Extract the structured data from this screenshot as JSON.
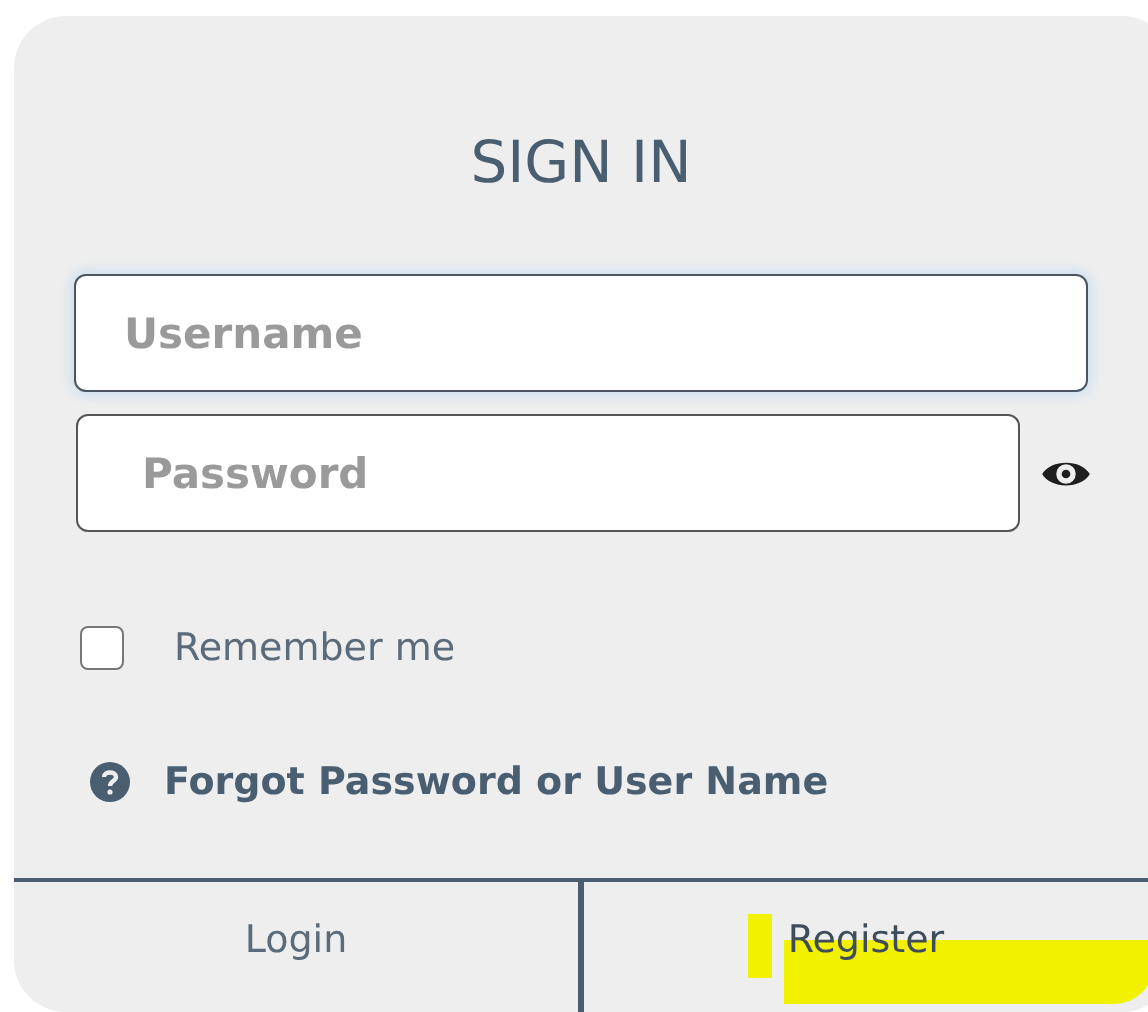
{
  "title": "SIGN IN",
  "fields": [
    {
      "kind": "text",
      "placeholder": "Username",
      "focused": true
    },
    {
      "kind": "password",
      "placeholder": "Password",
      "focused": false
    }
  ],
  "remember": {
    "label": "Remember me",
    "checked": false
  },
  "forgot_link": "Forgot Password or User Name",
  "actions": [
    {
      "label": "Login",
      "highlighted": false
    },
    {
      "label": "Register",
      "highlighted": true
    }
  ]
}
